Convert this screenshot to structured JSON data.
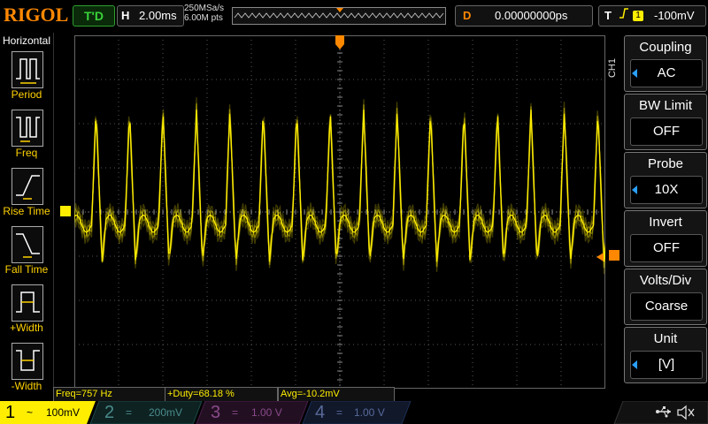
{
  "header": {
    "logo": "RIGOL",
    "run_state": "T'D",
    "horiz_label": "H",
    "timebase": "2.00ms",
    "sample_rate": "250MSa/s",
    "memory_depth": "6.00M pts",
    "delay_label": "D",
    "delay": "0.00000000ps",
    "trigger_label": "T",
    "trigger_channel": "1",
    "trigger_level": "-100mV"
  },
  "horizontal_menu": {
    "title": "Horizontal",
    "items": [
      {
        "label": "Period",
        "icon": "period-icon"
      },
      {
        "label": "Freq",
        "icon": "frequency-icon"
      },
      {
        "label": "Rise Time",
        "icon": "rise-time-icon"
      },
      {
        "label": "Fall Time",
        "icon": "fall-time-icon"
      },
      {
        "label": "+Width",
        "icon": "positive-width-icon"
      },
      {
        "label": "-Width",
        "icon": "negative-width-icon"
      }
    ]
  },
  "channel_menu": {
    "channel": "CH1",
    "items": [
      {
        "title": "Coupling",
        "value": "AC",
        "arrow": true
      },
      {
        "title": "BW Limit",
        "value": "OFF",
        "arrow": false
      },
      {
        "title": "Probe",
        "value": "10X",
        "arrow": true
      },
      {
        "title": "Invert",
        "value": "OFF",
        "arrow": false
      },
      {
        "title": "Volts/Div",
        "value": "Coarse",
        "arrow": false
      },
      {
        "title": "Unit",
        "value": "[V]",
        "arrow": true
      }
    ]
  },
  "markers": {
    "trigger_top": "T",
    "ch1_offset": "1",
    "trigger_level": "T"
  },
  "measurements": {
    "freq": "Freq=757 Hz",
    "duty": "+Duty=68.18 %",
    "avg": "Avg=-10.2mV"
  },
  "channels": [
    {
      "num": "1",
      "coupling": "~",
      "scale": "100mV",
      "color": "#ffee00",
      "active": true
    },
    {
      "num": "2",
      "coupling": "=",
      "scale": "200mV",
      "color": "#00e0e0",
      "active": false
    },
    {
      "num": "3",
      "coupling": "=",
      "scale": "1.00 V",
      "color": "#ff00ff",
      "active": false
    },
    {
      "num": "4",
      "coupling": "=",
      "scale": "1.00 V",
      "color": "#3a7cff",
      "active": false
    }
  ],
  "colors": {
    "ch1": "#ffee00",
    "accent_orange": "#ff8800",
    "grid": "#555555"
  },
  "status_icons": [
    "usb-icon",
    "speaker-muted-icon"
  ]
}
